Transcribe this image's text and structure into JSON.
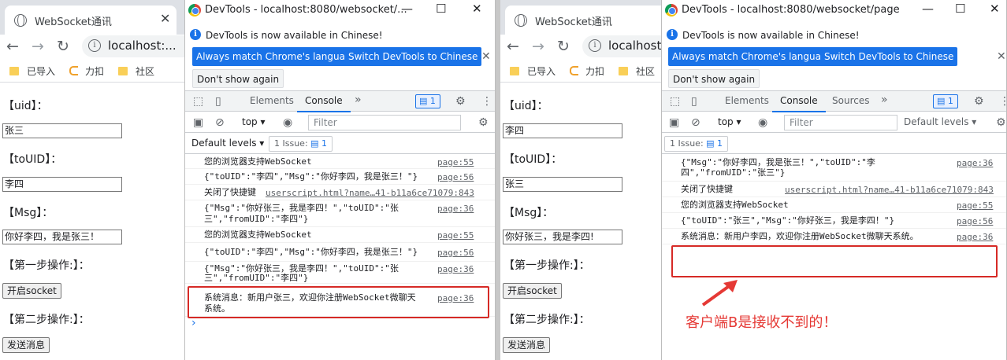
{
  "client_a": {
    "tab_title": "WebSocket通讯",
    "tab_close": "✕",
    "url": "localhost:...",
    "bookmarks": [
      "已导入",
      "力扣",
      "社区"
    ],
    "uid_label": "【uid】：",
    "uid_value": "张三",
    "touid_label": "【toUID】：",
    "touid_value": "李四",
    "msg_label": "【Msg】：",
    "msg_value": "你好李四，我是张三！",
    "step1_label": "【第一步操作:】：",
    "open_button": "开启socket",
    "step2_label": "【第二步操作:】：",
    "send_button": "发送消息"
  },
  "client_b": {
    "tab_title": "WebSocket通讯",
    "tab_close": "✕",
    "url": "localhost:...",
    "bookmarks": [
      "已导入",
      "力扣",
      "社区"
    ],
    "uid_label": "【uid】：",
    "uid_value": "李四",
    "touid_label": "【toUID】：",
    "touid_value": "张三",
    "msg_label": "【Msg】：",
    "msg_value": "你好张三，我是李四!",
    "step1_label": "【第一步操作:】：",
    "open_button": "开启socket",
    "step2_label": "【第二步操作:】：",
    "send_button": "发送消息"
  },
  "devtools_a": {
    "title": "DevTools - localhost:8080/websocket/...",
    "info_text": "DevTools is now available in Chinese!",
    "btn_match": "Always match Chrome's language",
    "btn_switch": "Switch DevTools to Chinese",
    "btn_dont": "Don't show again",
    "tabs": [
      "Elements",
      "Console"
    ],
    "more": "»",
    "badge": "1",
    "context": "top",
    "filter_placeholder": "Filter",
    "levels": "Default levels",
    "issue": "1 Issue:",
    "issue_count": "1",
    "prompt": "›",
    "messages": [
      {
        "l1": "您的浏览器支持WebSocket",
        "l2": "",
        "src": "page:55"
      },
      {
        "l1": "{\"toUID\":\"李四\",\"Msg\":\"你好李四，我是张三！\"}",
        "l2": "",
        "src": "page:56"
      },
      {
        "l1": "关闭了快捷键",
        "l2": "",
        "src": "userscript.html?name…41-b11a6ce71079:843"
      },
      {
        "l1": "{\"Msg\":\"你好张三，我是李四！\",\"toUID\":\"张",
        "l2": "三\",\"fromUID\":\"李四\"}",
        "src": "page:36"
      },
      {
        "l1": "您的浏览器支持WebSocket",
        "l2": "",
        "src": "page:55"
      },
      {
        "l1": "{\"toUID\":\"李四\",\"Msg\":\"你好李四，我是张三！\"}",
        "l2": "",
        "src": "page:56"
      },
      {
        "l1": "{\"Msg\":\"你好张三，我是李四！\",\"toUID\":\"张",
        "l2": "三\",\"fromUID\":\"李四\"}",
        "src": "page:36"
      },
      {
        "l1": "系统消息：新用户张三，欢迎你注册WebSocket微聊天",
        "l2": "系统。",
        "src": "page:36"
      }
    ]
  },
  "devtools_b": {
    "title": "DevTools - localhost:8080/websocket/page",
    "info_text": "DevTools is now available in Chinese!",
    "btn_match": "Always match Chrome's language",
    "btn_switch": "Switch DevTools to Chinese",
    "btn_dont": "Don't show again",
    "tabs": [
      "Elements",
      "Console",
      "Sources"
    ],
    "more": "»",
    "badge": "1",
    "context": "top",
    "filter_placeholder": "Filter",
    "levels": "Default levels",
    "issue": "1 Issue:",
    "issue_count": "1",
    "messages": [
      {
        "l1": "{\"Msg\":\"你好李四，我是张三！\",\"toUID\":\"李",
        "l2": "四\",\"fromUID\":\"张三\"}",
        "src": "page:36"
      },
      {
        "l1": "关闭了快捷键",
        "l2": "",
        "src": "userscript.html?name…41-b11a6ce71079:843"
      },
      {
        "l1": "您的浏览器支持WebSocket",
        "l2": "",
        "src": "page:55"
      },
      {
        "l1": "{\"toUID\":\"张三\",\"Msg\":\"你好张三，我是李四！\"}",
        "l2": "",
        "src": "page:56"
      },
      {
        "l1": "系统消息：新用户李四，欢迎你注册WebSocket微聊天系统。",
        "l2": "",
        "src": "page:36"
      }
    ]
  },
  "annotation": "客户端B是接收不到的！",
  "colors": {
    "annotation": "#e53935",
    "highlight_box": "#d62a26",
    "accent": "#1a73e8"
  }
}
